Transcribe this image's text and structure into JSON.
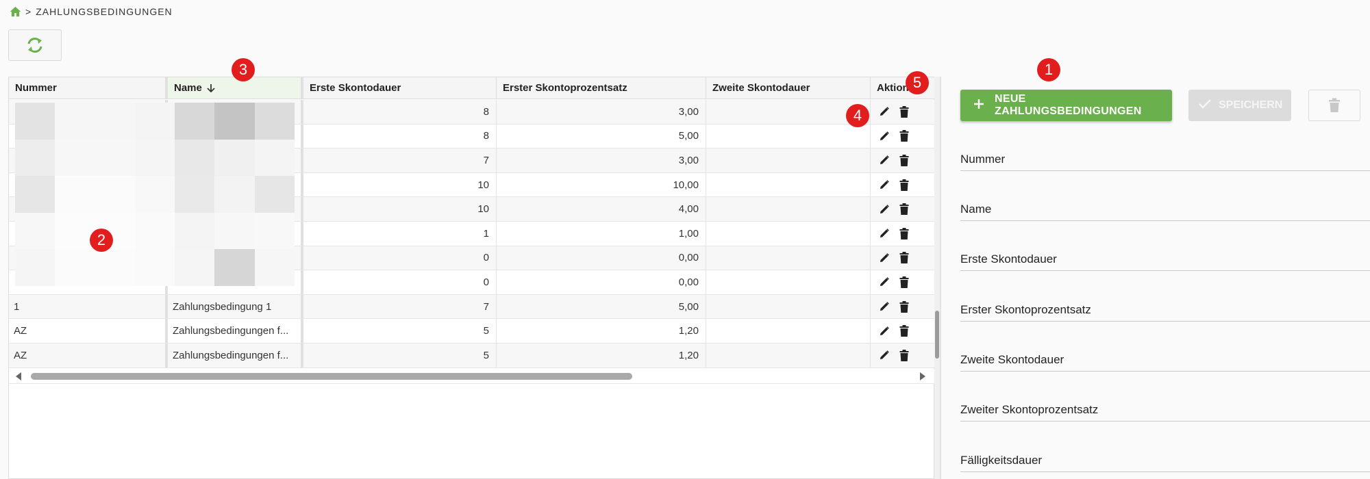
{
  "colors": {
    "accent_green": "#6ab04c",
    "badge_red": "#e11d1d",
    "icon_dark": "#222222"
  },
  "breadcrumb": {
    "home_icon": "home-icon",
    "separator": ">",
    "current": "ZAHLUNGSBEDINGUNGEN"
  },
  "toolbar": {
    "refresh_icon": "refresh-icon"
  },
  "table": {
    "columns": [
      "Nummer",
      "Name",
      "Erste Skontodauer",
      "Erster Skontoprozentsatz",
      "Zweite Skontodauer",
      "Aktion"
    ],
    "sorted_column": "Name",
    "sort_direction": "descending",
    "rows": [
      {
        "nummer": "",
        "name": "",
        "erste_dauer": "8",
        "erster_satz": "3,00",
        "zweite_dauer": ""
      },
      {
        "nummer": "",
        "name": "",
        "erste_dauer": "8",
        "erster_satz": "5,00",
        "zweite_dauer": ""
      },
      {
        "nummer": "",
        "name": "",
        "erste_dauer": "7",
        "erster_satz": "3,00",
        "zweite_dauer": ""
      },
      {
        "nummer": "",
        "name": "",
        "erste_dauer": "10",
        "erster_satz": "10,00",
        "zweite_dauer": ""
      },
      {
        "nummer": "",
        "name": "",
        "erste_dauer": "10",
        "erster_satz": "4,00",
        "zweite_dauer": ""
      },
      {
        "nummer": "",
        "name": "",
        "erste_dauer": "1",
        "erster_satz": "1,00",
        "zweite_dauer": ""
      },
      {
        "nummer": "",
        "name": "",
        "erste_dauer": "0",
        "erster_satz": "0,00",
        "zweite_dauer": ""
      },
      {
        "nummer": "",
        "name": "",
        "erste_dauer": "0",
        "erster_satz": "0,00",
        "zweite_dauer": ""
      },
      {
        "nummer": "1",
        "name": "Zahlungsbedingung 1",
        "erste_dauer": "7",
        "erster_satz": "5,00",
        "zweite_dauer": ""
      },
      {
        "nummer": "AZ",
        "name": "Zahlungsbedingungen f...",
        "erste_dauer": "5",
        "erster_satz": "1,20",
        "zweite_dauer": ""
      },
      {
        "nummer": "AZ",
        "name": "Zahlungsbedingungen f...",
        "erste_dauer": "5",
        "erster_satz": "1,20",
        "zweite_dauer": ""
      }
    ]
  },
  "form": {
    "new_button_label": "NEUE ZAHLUNGSBEDINGUNGEN",
    "save_button_label": "SPEICHERN",
    "fields": [
      "Nummer",
      "Name",
      "Erste Skontodauer",
      "Erster Skontoprozentsatz",
      "Zweite Skontodauer",
      "Zweiter Skontoprozentsatz",
      "Fälligkeitsdauer"
    ]
  },
  "badges": [
    "1",
    "2",
    "3",
    "4",
    "5"
  ]
}
